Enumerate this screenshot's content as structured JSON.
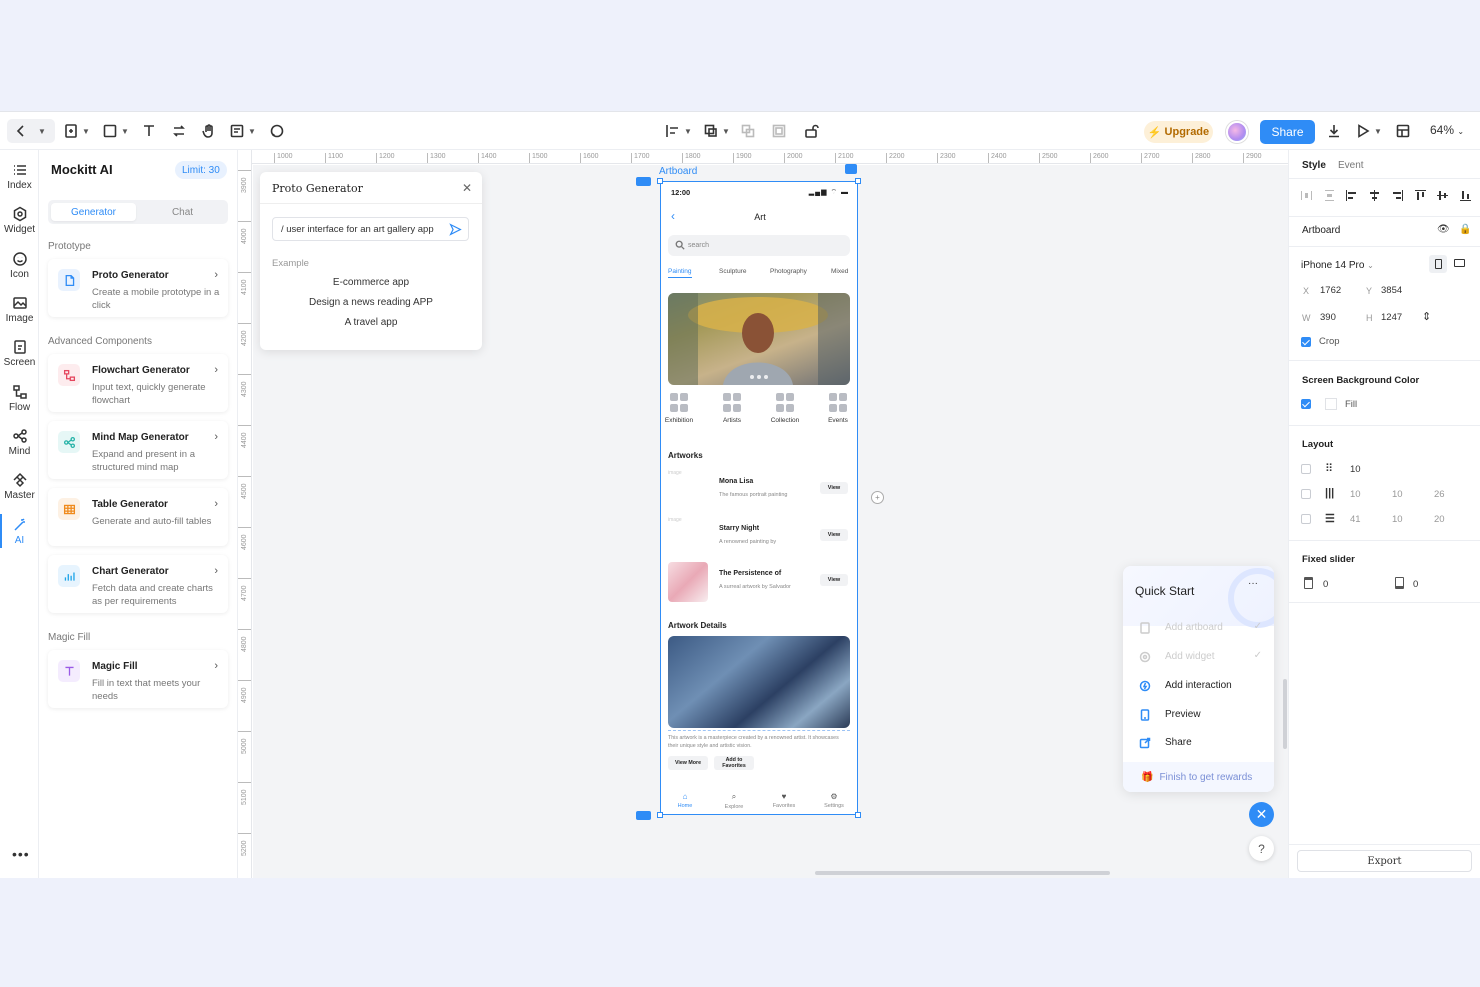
{
  "toolbar": {
    "upgrade_label": "Upgrade",
    "share_label": "Share",
    "zoom": "64%"
  },
  "rail": {
    "items": [
      {
        "label": "Index",
        "icon": "list-icon"
      },
      {
        "label": "Widget",
        "icon": "hexagon-icon"
      },
      {
        "label": "Icon",
        "icon": "smile-icon"
      },
      {
        "label": "Image",
        "icon": "image-icon"
      },
      {
        "label": "Screen",
        "icon": "screen-icon"
      },
      {
        "label": "Flow",
        "icon": "flow-icon"
      },
      {
        "label": "Mind",
        "icon": "mindmap-icon"
      },
      {
        "label": "Master",
        "icon": "master-icon"
      },
      {
        "label": "AI",
        "icon": "magic-wand-icon"
      }
    ],
    "more": "•••"
  },
  "ai_panel": {
    "title": "Mockitt AI",
    "limit": "Limit: 30",
    "tabs": [
      "Generator",
      "Chat"
    ],
    "sections": {
      "prototype": "Prototype",
      "advanced": "Advanced Components",
      "magic": "Magic Fill"
    },
    "cards": [
      {
        "title": "Proto Generator",
        "desc": "Create a mobile prototype in a click"
      },
      {
        "title": "Flowchart Generator",
        "desc": "Input text, quickly generate flowchart"
      },
      {
        "title": "Mind Map Generator",
        "desc": "Expand and present in a structured mind map"
      },
      {
        "title": "Table Generator",
        "desc": "Generate and auto-fill tables"
      },
      {
        "title": "Chart Generator",
        "desc": "Fetch data and create charts as per requirements"
      },
      {
        "title": "Magic Fill",
        "desc": "Fill in text that meets your needs"
      }
    ]
  },
  "rulers": {
    "h": [
      "1000",
      "1100",
      "1200",
      "1300",
      "1400",
      "1500",
      "1600",
      "1700",
      "1800",
      "1900",
      "2000",
      "2100",
      "2200",
      "2300",
      "2400",
      "2500",
      "2600",
      "2700",
      "2800",
      "2900"
    ],
    "v": [
      "3900",
      "4000",
      "4100",
      "4200",
      "4300",
      "4400",
      "4500",
      "4600",
      "4700",
      "4800",
      "4900",
      "5000",
      "5100",
      "5200"
    ]
  },
  "proto_generator": {
    "title": "Proto Generator",
    "input_value": "/ user interface for an art gallery app",
    "example_label": "Example",
    "examples": [
      "E-commerce app",
      "Design a news reading APP",
      "A travel app"
    ]
  },
  "artboard": {
    "label": "Artboard",
    "phone": {
      "time": "12:00",
      "status": "▂▄▆ ⌔ ▬",
      "back": "‹",
      "title": "Art",
      "search_placeholder": "search",
      "tabs": [
        "Painting",
        "Sculpture",
        "Photography",
        "Mixed"
      ],
      "categories": [
        "Exhibition",
        "Artists",
        "Collection",
        "Events"
      ],
      "artworks_heading": "Artworks",
      "artworks": [
        {
          "title": "Mona Lisa",
          "desc": "The famous portrait painting",
          "thumb": "image",
          "button": "View"
        },
        {
          "title": "Starry Night",
          "desc": "A renowned painting by",
          "thumb": "image",
          "button": "View"
        },
        {
          "title": "The Persistence of",
          "desc": "A surreal artwork by Salvador",
          "thumb": "",
          "button": "View"
        }
      ],
      "details_heading": "Artwork Details",
      "details_desc": "This artwork is a masterpiece created by a renowned artist. It showcases their unique style and artistic vision.",
      "view_more": "View More",
      "add_fav": "Add to Favorites",
      "nav": [
        {
          "label": "Home",
          "icon": "⌂"
        },
        {
          "label": "Explore",
          "icon": "⌕"
        },
        {
          "label": "Favorites",
          "icon": "♥"
        },
        {
          "label": "Settings",
          "icon": "⚙"
        }
      ]
    }
  },
  "quick_start": {
    "title": "Quick Start",
    "more": "···",
    "items": [
      {
        "label": "Add artboard",
        "done": true
      },
      {
        "label": "Add widget",
        "done": true
      },
      {
        "label": "Add interaction",
        "done": false
      },
      {
        "label": "Preview",
        "done": false
      },
      {
        "label": "Share",
        "done": false
      }
    ],
    "check": "✓",
    "footer": "Finish to get rewards"
  },
  "fab": {
    "close": "✕",
    "help": "?"
  },
  "right_panel": {
    "tabs": [
      "Style",
      "Event"
    ],
    "artboard_label": "Artboard",
    "device": "iPhone 14 Pro",
    "x_label": "X",
    "x": "1762",
    "y_label": "Y",
    "y": "3854",
    "w_label": "W",
    "w": "390",
    "h_label": "H",
    "h": "1247",
    "crop": "Crop",
    "bg_heading": "Screen Background Color",
    "fill": "Fill",
    "layout_heading": "Layout",
    "layout_rows": [
      [
        "10",
        "",
        ""
      ],
      [
        "10",
        "10",
        "26"
      ],
      [
        "41",
        "10",
        "20"
      ]
    ],
    "fixed_heading": "Fixed slider",
    "fixed_top": "0",
    "fixed_bottom": "0",
    "export": "Export"
  },
  "colors": {
    "accent": "#2f8cf6",
    "upgrade": "#b26a00"
  }
}
